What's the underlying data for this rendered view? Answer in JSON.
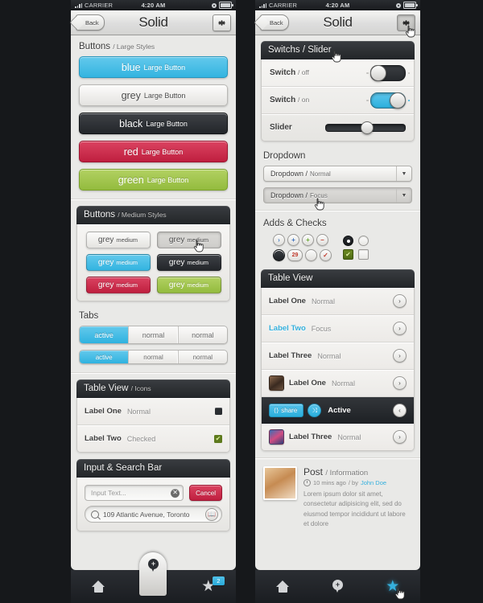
{
  "statusbar": {
    "carrier": "CARRIER",
    "time": "4:20 AM"
  },
  "navbar": {
    "back_label": "Back",
    "title": "Solid",
    "gear_icon": "gear-icon"
  },
  "left_panel": {
    "buttons_large": {
      "title": "Buttons",
      "subtitle": "/ Large Styles",
      "items": [
        {
          "name": "blue",
          "label": "Large Button",
          "color": "#33b4e0"
        },
        {
          "name": "grey",
          "label": "Large Button",
          "color": "#e4e3e0"
        },
        {
          "name": "black",
          "label": "Large Button",
          "color": "#23262a"
        },
        {
          "name": "red",
          "label": "Large Button",
          "color": "#bf1f3f"
        },
        {
          "name": "green",
          "label": "Large Button",
          "color": "#93bb3e"
        }
      ]
    },
    "buttons_medium": {
      "title": "Buttons",
      "subtitle": "/ Medium Styles",
      "items": [
        {
          "name": "grey",
          "label": "medium",
          "state": "normal",
          "color": "#e4e3e0"
        },
        {
          "name": "grey",
          "label": "medium",
          "state": "pressed",
          "color": "#cecdca"
        },
        {
          "name": "grey",
          "label": "medium",
          "state": "normal",
          "color": "#33b4e0"
        },
        {
          "name": "grey",
          "label": "medium",
          "state": "normal",
          "color": "#23262a"
        },
        {
          "name": "grey",
          "label": "medium",
          "state": "normal",
          "color": "#bf1f3f"
        },
        {
          "name": "grey",
          "label": "medium",
          "state": "normal",
          "color": "#93bb3e"
        }
      ]
    },
    "tabs": {
      "title": "Tabs",
      "row1": [
        {
          "label": "active",
          "state": "active"
        },
        {
          "label": "normal",
          "state": "normal"
        },
        {
          "label": "normal",
          "state": "normal"
        }
      ],
      "row2": [
        {
          "label": "active",
          "state": "active"
        },
        {
          "label": "normal",
          "state": "normal"
        },
        {
          "label": "normal",
          "state": "normal"
        }
      ]
    },
    "table_view": {
      "title": "Table View",
      "subtitle": "/ Icons",
      "rows": [
        {
          "label": "Label One",
          "status": "Normal",
          "icon": "dark-square-icon"
        },
        {
          "label": "Label Two",
          "status": "Checked",
          "icon": "green-check-icon"
        }
      ]
    },
    "input_search": {
      "title": "Input & Search Bar",
      "input_value": "Input Text...",
      "clear_icon": "clear-circle-icon",
      "cancel_label": "Cancel",
      "search_value": "109 Atlantic Avenue, Toronto",
      "search_icon": "magnifier-icon",
      "book_icon": "contacts-book-icon"
    }
  },
  "right_panel": {
    "switches": {
      "title": "Switchs / Slider",
      "rows": [
        {
          "label": "Switch",
          "sub": "/ off",
          "state": "off"
        },
        {
          "label": "Switch",
          "sub": "/ on",
          "state": "on"
        }
      ],
      "slider": {
        "label": "Slider",
        "value": 52
      }
    },
    "dropdown": {
      "title": "Dropdown",
      "items": [
        {
          "label": "Dropdown /",
          "sub": "Normal",
          "state": "normal"
        },
        {
          "label": "Dropdown /",
          "sub": "Focus",
          "state": "focus"
        }
      ]
    },
    "adds_checks": {
      "title": "Adds & Checks",
      "row1": [
        {
          "glyph": "›",
          "name": "chevron-circle-button",
          "color": "#4a7fc1"
        },
        {
          "glyph": "+",
          "name": "plus-blue-circle-button",
          "color": "#3b6fbf"
        },
        {
          "glyph": "+",
          "name": "plus-green-circle-button",
          "color": "#6aa832"
        },
        {
          "glyph": "–",
          "name": "minus-red-circle-button",
          "color": "#c0392b"
        }
      ],
      "row2": [
        {
          "glyph": "",
          "name": "solid-dark-circle-button",
          "color": "#23262a"
        },
        {
          "glyph": "29",
          "name": "count-badge-button",
          "color": "#c0392b"
        },
        {
          "glyph": "",
          "name": "empty-circle-button",
          "color": "#ffffff"
        },
        {
          "glyph": "✓",
          "name": "check-red-circle-button",
          "color": "#c0392b"
        }
      ],
      "radio": [
        {
          "state": "on",
          "name": "radio-selected"
        },
        {
          "state": "off",
          "name": "radio-unselected"
        }
      ],
      "checkbox": [
        {
          "state": "on",
          "name": "checkbox-checked",
          "glyph": "✔"
        },
        {
          "state": "off",
          "name": "checkbox-unchecked",
          "glyph": ""
        }
      ]
    },
    "table_view": {
      "title": "Table View",
      "rows": [
        {
          "type": "plain",
          "label": "Label One",
          "status": "Normal",
          "state": "normal",
          "chevron": "›"
        },
        {
          "type": "plain",
          "label": "Label Two",
          "status": "Focus",
          "state": "focus",
          "chevron": "›"
        },
        {
          "type": "plain",
          "label": "Label Three",
          "status": "Normal",
          "state": "normal",
          "chevron": "›"
        },
        {
          "type": "avatar",
          "label": "Label One",
          "status": "Normal",
          "state": "normal",
          "chevron": "›",
          "avatar": "avatar-one"
        },
        {
          "type": "active",
          "share_label": "share",
          "shuffle_icon": "⤨",
          "label": "Active",
          "chevron": "‹"
        },
        {
          "type": "avatar",
          "label": "Label Three",
          "status": "Normal",
          "state": "normal",
          "chevron": "›",
          "avatar": "avatar-three"
        }
      ]
    },
    "post": {
      "title": "Post",
      "subtitle": "/ Information",
      "meta_time": "10 mins ago",
      "meta_by": "/ by",
      "meta_author": "John Doe",
      "body": "Lorem ipsum dolor sit amet, consectetur adipisicing elit, sed do eiusmod tempor incididunt ut labore et dolore"
    }
  },
  "tabbar": {
    "left": [
      {
        "icon": "home-icon",
        "state": "normal"
      },
      {
        "icon": "pin-icon",
        "state": "raised"
      },
      {
        "icon": "star-icon",
        "state": "normal",
        "badge": "2"
      }
    ],
    "right": [
      {
        "icon": "home-icon",
        "state": "normal"
      },
      {
        "icon": "pin-icon",
        "state": "normal"
      },
      {
        "icon": "star-icon",
        "state": "active"
      }
    ]
  }
}
